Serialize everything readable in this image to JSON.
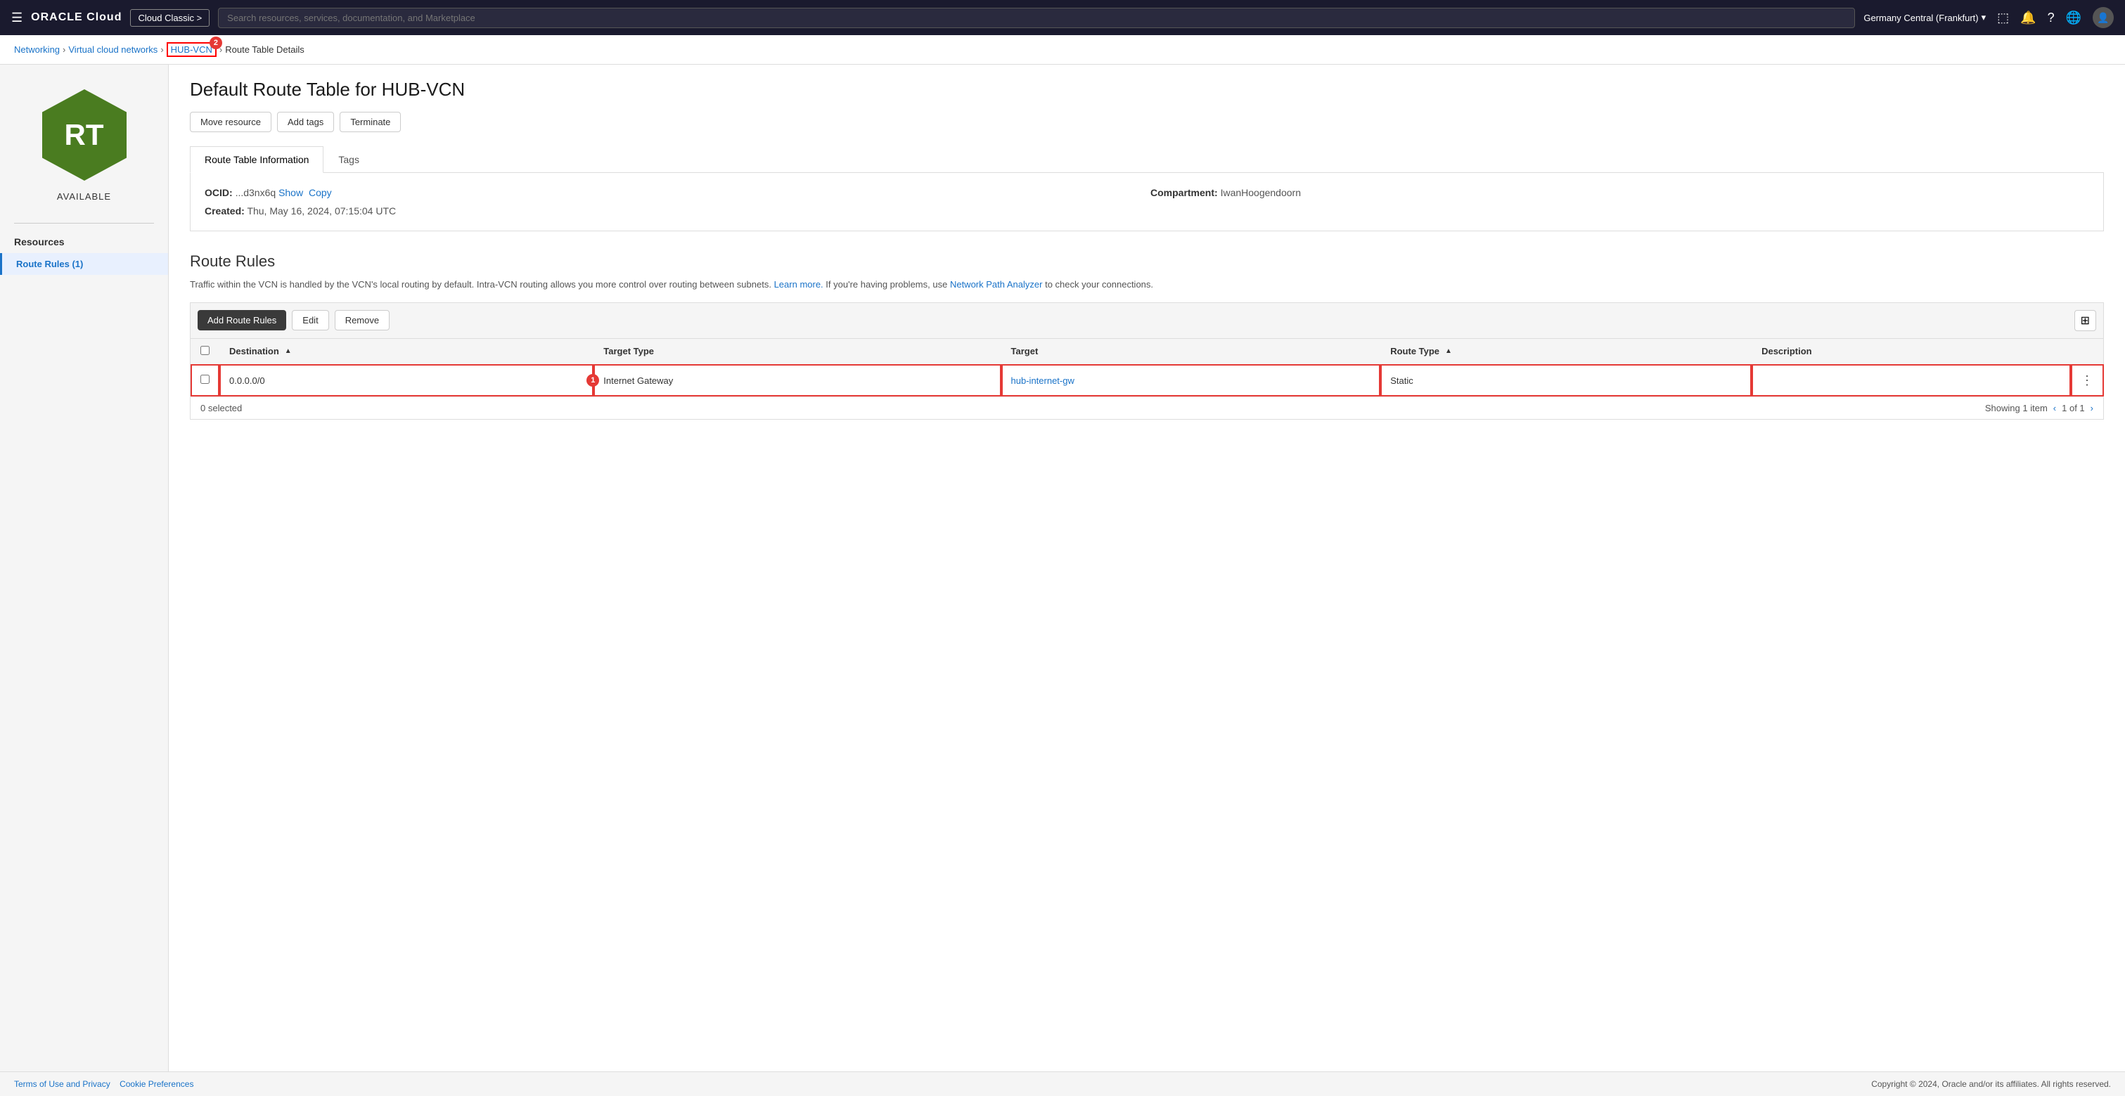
{
  "topnav": {
    "logo_oracle": "ORACLE",
    "logo_cloud": "Cloud",
    "cloud_classic_label": "Cloud Classic >",
    "search_placeholder": "Search resources, services, documentation, and Marketplace",
    "region": "Germany Central (Frankfurt)",
    "region_arrow": "▾"
  },
  "breadcrumb": {
    "networking": "Networking",
    "vcn": "Virtual cloud networks",
    "hub_vcn": "HUB-VCN",
    "hub_vcn_badge": "2",
    "current": "Route Table Details"
  },
  "sidebar": {
    "icon_text": "RT",
    "status": "AVAILABLE",
    "resources_title": "Resources",
    "items": [
      {
        "label": "Route Rules (1)",
        "active": true
      }
    ]
  },
  "page": {
    "title": "Default Route Table for HUB-VCN",
    "buttons": {
      "move_resource": "Move resource",
      "add_tags": "Add tags",
      "terminate": "Terminate"
    }
  },
  "tabs": [
    {
      "label": "Route Table Information",
      "active": true
    },
    {
      "label": "Tags",
      "active": false
    }
  ],
  "info_panel": {
    "ocid_label": "OCID:",
    "ocid_value": "...d3nx6q",
    "ocid_show": "Show",
    "ocid_copy": "Copy",
    "compartment_label": "Compartment:",
    "compartment_value": "IwanHoogendoorn",
    "created_label": "Created:",
    "created_value": "Thu, May 16, 2024, 07:15:04 UTC"
  },
  "route_rules": {
    "section_title": "Route Rules",
    "description": "Traffic within the VCN is handled by the VCN's local routing by default. Intra-VCN routing allows you more control over routing between subnets.",
    "learn_more": "Learn more.",
    "description2": "If you're having problems, use",
    "network_path": "Network Path Analyzer",
    "description3": "to check your connections.",
    "toolbar": {
      "add_route_rules": "Add Route Rules",
      "edit": "Edit",
      "remove": "Remove"
    },
    "table": {
      "columns": [
        {
          "label": "Destination",
          "sortable": true
        },
        {
          "label": "Target Type",
          "sortable": false
        },
        {
          "label": "Target",
          "sortable": false
        },
        {
          "label": "Route Type",
          "sortable": true
        },
        {
          "label": "Description",
          "sortable": false
        }
      ],
      "rows": [
        {
          "destination": "0.0.0.0/0",
          "target_type": "Internet Gateway",
          "target": "hub-internet-gw",
          "route_type": "Static",
          "description": "",
          "highlighted": true
        }
      ]
    },
    "footer": {
      "selected": "0 selected",
      "showing": "Showing 1 item",
      "page": "1 of 1"
    }
  },
  "footer": {
    "terms": "Terms of Use and Privacy",
    "cookie": "Cookie Preferences",
    "copyright": "Copyright © 2024, Oracle and/or its affiliates. All rights reserved."
  }
}
